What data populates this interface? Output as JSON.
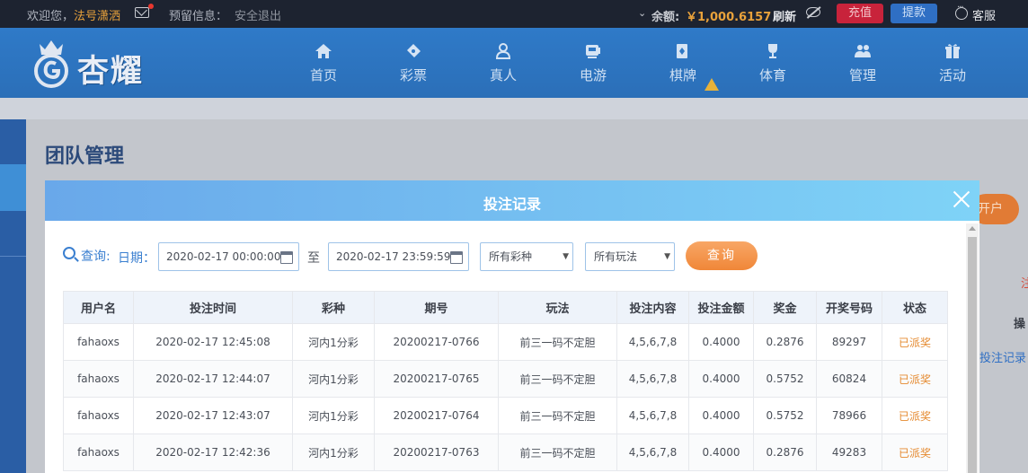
{
  "topbar": {
    "welcome": "欢迎您，",
    "username": "法号潇洒",
    "reserved_info": "预留信息：",
    "logout": "安全退出",
    "balance_label": "余额:",
    "balance": "￥1,000.6157",
    "refresh": "刷新",
    "recharge": "充值",
    "withdraw": "提款",
    "customer_service": "客服"
  },
  "logo": {
    "text": "杏耀"
  },
  "nav": [
    {
      "label": "首页",
      "icon": "home-icon"
    },
    {
      "label": "彩票",
      "icon": "ticket-icon"
    },
    {
      "label": "真人",
      "icon": "person-icon"
    },
    {
      "label": "电游",
      "icon": "gamepad-icon"
    },
    {
      "label": "棋牌",
      "icon": "cards-icon"
    },
    {
      "label": "体育",
      "icon": "trophy-icon"
    },
    {
      "label": "管理",
      "icon": "users-icon"
    },
    {
      "label": "活动",
      "icon": "gift-icon"
    }
  ],
  "page": {
    "title": "团队管理",
    "open_account_fragment": "开户",
    "operation_fragment": "操",
    "bet_record_link": "投注记录"
  },
  "modal": {
    "title": "投注记录",
    "query_label": "查询:",
    "date_label": "日期：",
    "start_date": "2020-02-17 00:00:00",
    "to_label": "至",
    "end_date": "2020-02-17 23:59:59",
    "lottery_select": "所有彩种",
    "play_select": "所有玩法",
    "query_button": "查询"
  },
  "table": {
    "headers": [
      "用户名",
      "投注时间",
      "彩种",
      "期号",
      "玩法",
      "投注内容",
      "投注金额",
      "奖金",
      "开奖号码",
      "状态"
    ],
    "rows": [
      [
        "fahaoxs",
        "2020-02-17 12:45:08",
        "河内1分彩",
        "20200217-0766",
        "前三一码不定胆",
        "4,5,6,7,8",
        "0.4000",
        "0.2876",
        "89297",
        "已派奖"
      ],
      [
        "fahaoxs",
        "2020-02-17 12:44:07",
        "河内1分彩",
        "20200217-0765",
        "前三一码不定胆",
        "4,5,6,7,8",
        "0.4000",
        "0.5752",
        "60824",
        "已派奖"
      ],
      [
        "fahaoxs",
        "2020-02-17 12:43:07",
        "河内1分彩",
        "20200217-0764",
        "前三一码不定胆",
        "4,5,6,7,8",
        "0.4000",
        "0.5752",
        "78966",
        "已派奖"
      ],
      [
        "fahaoxs",
        "2020-02-17 12:42:36",
        "河内1分彩",
        "20200217-0763",
        "前三一码不定胆",
        "4,5,6,7,8",
        "0.4000",
        "0.2876",
        "49283",
        "已派奖"
      ]
    ]
  },
  "colors": {
    "accent_blue": "#3a7fd0",
    "paid_status": "#e58a2f",
    "balance": "#e9a23b"
  }
}
